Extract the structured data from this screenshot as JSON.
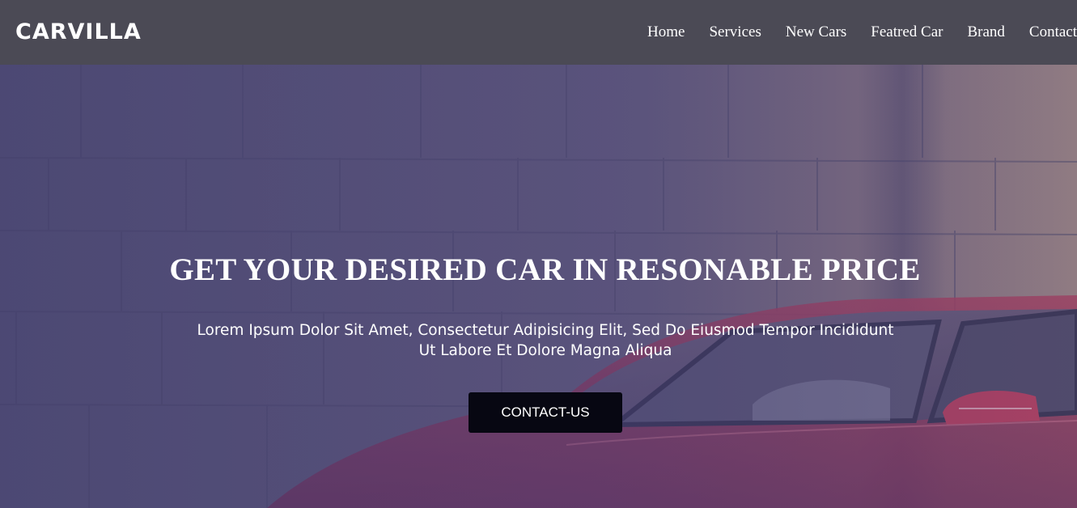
{
  "header": {
    "logo": "CARVILLA",
    "nav": [
      "Home",
      "Services",
      "New Cars",
      "Featred Car",
      "Brand",
      "Contact"
    ]
  },
  "hero": {
    "title": "GET YOUR DESIRED CAR IN RESONABLE PRICE",
    "subtitle": "Lorem Ipsum Dolor Sit Amet, Consectetur Adipisicing Elit, Sed Do Eiusmod Tempor Incididunt Ut Labore Et Dolore Magna Aliqua",
    "button_label": "CONTACT-US"
  },
  "colors": {
    "navbar": "#4b4a55",
    "button": "#070712",
    "text": "#ffffff",
    "car": "#a8344f"
  }
}
